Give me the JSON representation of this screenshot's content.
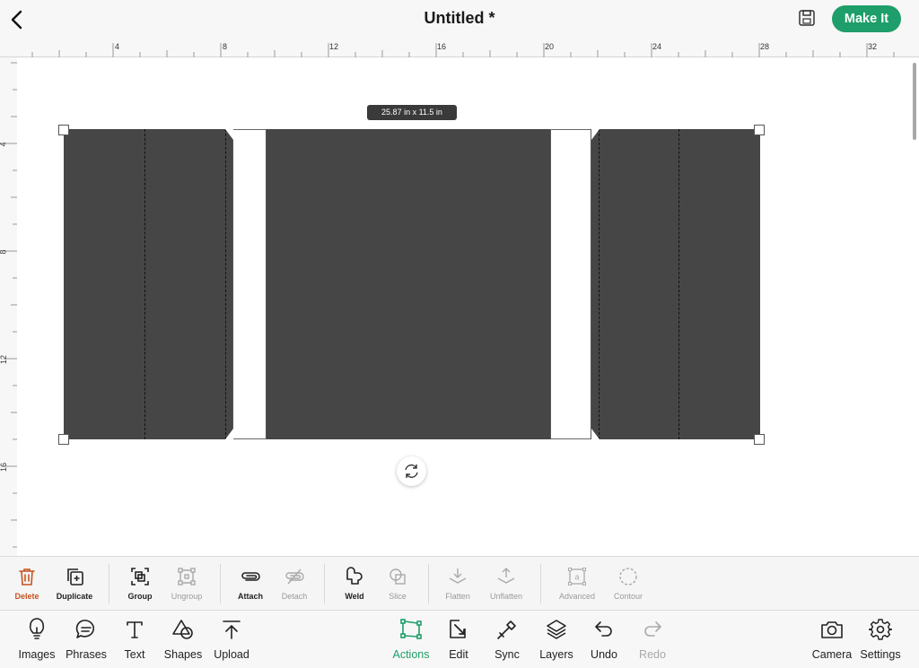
{
  "header": {
    "title": "Untitled *",
    "make_it_label": "Make It",
    "accent_color": "#1e9e6a"
  },
  "rulers": {
    "top": [
      "4",
      "8",
      "12",
      "16",
      "20",
      "24",
      "28",
      "32"
    ],
    "left": [
      "4",
      "8",
      "12",
      "16"
    ]
  },
  "canvas": {
    "dimension_badge": "25.87 in x 11.5 in",
    "shape_color": "#464646"
  },
  "actions": {
    "delete": "Delete",
    "duplicate": "Duplicate",
    "group": "Group",
    "ungroup": "Ungroup",
    "attach": "Attach",
    "detach": "Detach",
    "weld": "Weld",
    "slice": "Slice",
    "flatten": "Flatten",
    "unflatten": "Unflatten",
    "advanced": "Advanced",
    "contour": "Contour"
  },
  "nav": {
    "images": "Images",
    "phrases": "Phrases",
    "text": "Text",
    "shapes": "Shapes",
    "upload": "Upload",
    "actions": "Actions",
    "edit": "Edit",
    "sync": "Sync",
    "layers": "Layers",
    "undo": "Undo",
    "redo": "Redo",
    "camera": "Camera",
    "settings": "Settings"
  }
}
